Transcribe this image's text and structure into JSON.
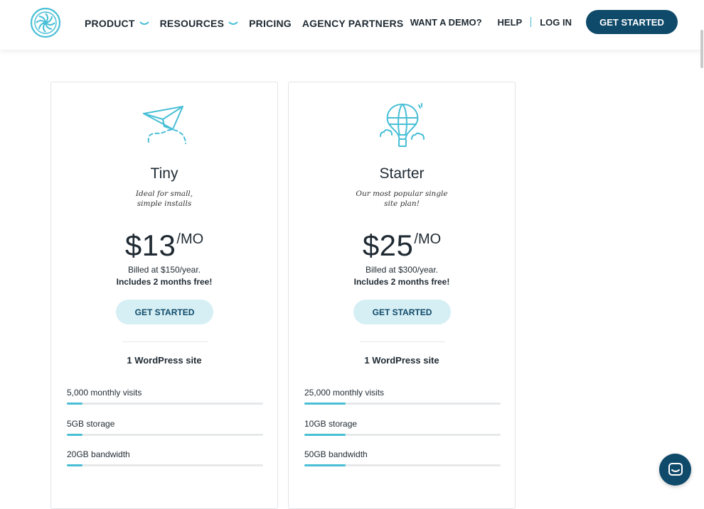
{
  "header": {
    "nav": [
      {
        "label": "PRODUCT",
        "has_dropdown": true
      },
      {
        "label": "RESOURCES",
        "has_dropdown": true
      },
      {
        "label": "PRICING",
        "has_dropdown": false
      },
      {
        "label": "AGENCY PARTNERS",
        "has_dropdown": false
      }
    ],
    "demo_label": "WANT A DEMO?",
    "help_label": "HELP",
    "login_label": "LOG IN",
    "cta_label": "GET STARTED",
    "logo_icon": "flywheel-logo-icon"
  },
  "plans": [
    {
      "icon": "paper-plane-icon",
      "name": "Tiny",
      "desc_line1": "Ideal for small,",
      "desc_line2": "simple installs",
      "price": "$13",
      "period": "/MO",
      "billed": "Billed at $150/year.",
      "free": "Includes 2 months free!",
      "cta": "GET STARTED",
      "sites": "1 WordPress site",
      "metrics": [
        {
          "label": "5,000 monthly visits",
          "level": 0.08
        },
        {
          "label": "5GB storage",
          "level": 0.08
        },
        {
          "label": "20GB bandwidth",
          "level": 0.08
        }
      ]
    },
    {
      "icon": "hot-air-balloon-icon",
      "name": "Starter",
      "desc_line1": "Our most popular single",
      "desc_line2": "site plan!",
      "price": "$25",
      "period": "/MO",
      "billed": "Billed at $300/year.",
      "free": "Includes 2 months free!",
      "cta": "GET STARTED",
      "sites": "1 WordPress site",
      "metrics": [
        {
          "label": "25,000 monthly visits",
          "level": 0.21
        },
        {
          "label": "10GB storage",
          "level": 0.21
        },
        {
          "label": "50GB bandwidth",
          "level": 0.21
        }
      ]
    }
  ],
  "colors": {
    "brand_dark": "#0f4a6a",
    "accent": "#48bfd6",
    "cta_light": "#d6eff4"
  },
  "chat_icon": "chat-bubble-icon"
}
